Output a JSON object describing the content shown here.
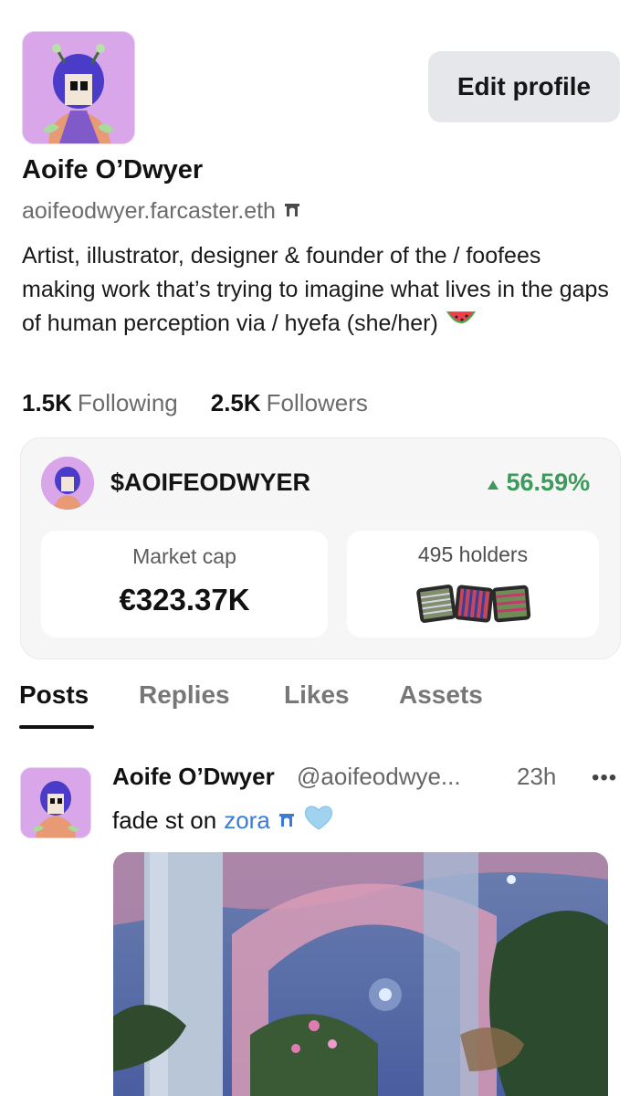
{
  "profile": {
    "display_name": "Aoife O’Dwyer",
    "handle": "aoifeodwyer.farcaster.eth",
    "bio": "Artist, illustrator, designer & founder of the / foofees making work that’s trying to imagine what lives in the gaps of human perception via / hyefa (she/her)",
    "edit_label": "Edit profile",
    "following_count": "1.5K",
    "following_label": "Following",
    "followers_count": "2.5K",
    "followers_label": "Followers"
  },
  "coin": {
    "ticker": "$AOIFEODWYER",
    "change": "56.59%",
    "market_cap_label": "Market cap",
    "market_cap_value": "€323.37K",
    "holders_label": "495 holders",
    "positive_color": "#3d9a5b"
  },
  "tabs": [
    {
      "label": "Posts",
      "active": true
    },
    {
      "label": "Replies",
      "active": false
    },
    {
      "label": "Likes",
      "active": false
    },
    {
      "label": "Assets",
      "active": false
    }
  ],
  "post": {
    "author": "Aoife O’Dwyer",
    "handle": "@aoifeodwye...",
    "time": "23h",
    "more": "•••",
    "text": "fade st on",
    "link": "zora",
    "emoji": "light-blue-heart"
  },
  "icons": {
    "handle_badge": "arch-badge-icon",
    "bio_emoji": "watermelon-icon",
    "change_arrow": "triangle-up-icon"
  }
}
